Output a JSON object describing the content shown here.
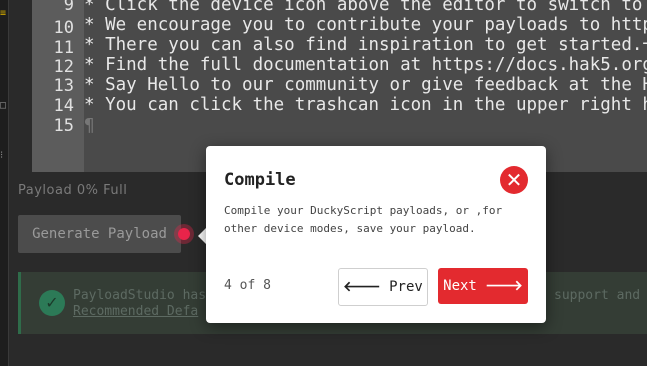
{
  "editor": {
    "lines": [
      {
        "num": "9",
        "text": "* Click the device icon above the editor to switch to US"
      },
      {
        "num": "10",
        "text": "* We encourage you to contribute your payloads to https:"
      },
      {
        "num": "11",
        "text": "* There you can also find inspiration to get started.¬"
      },
      {
        "num": "12",
        "text": "* Find the full documentation at https://docs.hak5.org¬"
      },
      {
        "num": "13",
        "text": "* Say Hello to our community or give feedback at the Hak"
      },
      {
        "num": "14",
        "text": "* You can click the trashcan icon in the upper right han"
      },
      {
        "num": "15",
        "text": "¶"
      }
    ]
  },
  "payload_status": "Payload 0% Full",
  "generate_button": "Generate Payload",
  "notice": {
    "line1_start": "PayloadStudio has",
    "line1_end": "support and",
    "line2": "Recommended Defa"
  },
  "tour": {
    "title": "Compile",
    "body": "Compile your DuckyScript payloads, or ,for other device modes, save your payload.",
    "step": "4 of 8",
    "prev_label": "Prev",
    "next_label": "Next"
  },
  "colors": {
    "accent": "#e32a2f",
    "success": "#2c7a57"
  }
}
